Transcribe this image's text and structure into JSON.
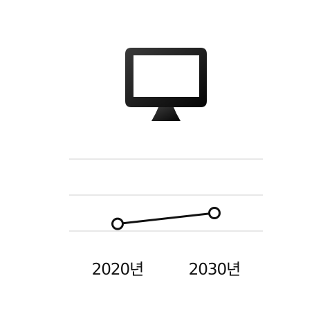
{
  "icon": {
    "name": "monitor-icon",
    "gradient_top": "#3a3a3a",
    "gradient_bottom": "#050505"
  },
  "chart_data": {
    "type": "line",
    "title": "",
    "xlabel": "",
    "ylabel": "",
    "categories": [
      "2020년",
      "2030년"
    ],
    "series": [
      {
        "values": [
          0.2,
          0.5
        ]
      }
    ],
    "ylim": [
      0,
      2.2
    ],
    "grid": true,
    "gridlines": [
      0,
      1,
      2
    ],
    "line_color": "#111111",
    "marker_fill": "#ffffff",
    "grid_color": "#d0d0d0"
  }
}
